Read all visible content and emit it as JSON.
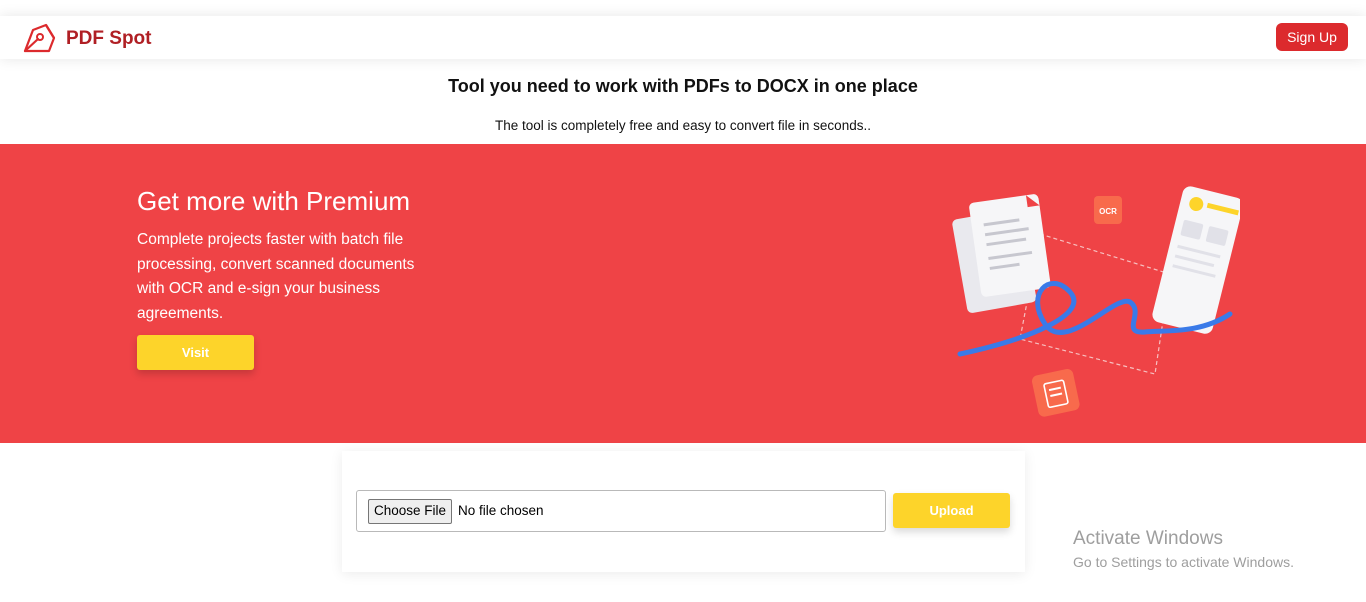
{
  "brand": {
    "name": "PDF Spot",
    "logo_icon": "pen-nib-icon",
    "color": "#b01f24"
  },
  "nav": {
    "signup_label": "Sign Up"
  },
  "hero": {
    "headline": "Tool you need to work with PDFs to DOCX in one place",
    "subline": "The tool is completely free and easy to convert file in seconds.."
  },
  "premium": {
    "title": "Get more with Premium",
    "description": "Complete projects faster with batch file processing, convert scanned documents with OCR and e-sign your business agreements.",
    "visit_label": "Visit",
    "background_color": "#ef4346",
    "illustration": {
      "ocr_badge": "OCR"
    }
  },
  "upload": {
    "choose_label": "Choose File",
    "status": "No file chosen",
    "upload_label": "Upload",
    "accent_color": "#fdd42a"
  },
  "watermark": {
    "title": "Activate Windows",
    "subtitle": "Go to Settings to activate Windows."
  }
}
